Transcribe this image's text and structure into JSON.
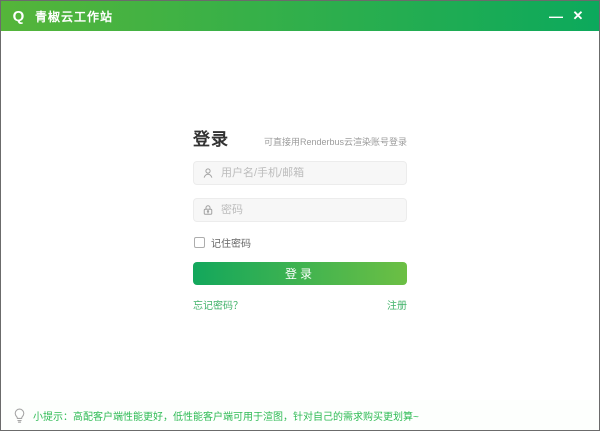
{
  "window": {
    "title": "青椒云工作站",
    "logo_glyph": "Q",
    "minimize_glyph": "—",
    "close_glyph": "✕"
  },
  "login": {
    "heading": "登录",
    "subtitle": "可直接用Renderbus云渲染账号登录",
    "username_placeholder": "用户名/手机/邮箱",
    "username_value": "",
    "password_placeholder": "密码",
    "password_value": "",
    "remember_label": "记住密码",
    "remember_checked": false,
    "submit_label": "登录",
    "forgot_label": "忘记密码？",
    "register_label": "注册"
  },
  "footer": {
    "tip": "小提示：高配客户端性能更好，低性能客户端可用于渲图，针对自己的需求购买更划算~"
  },
  "colors": {
    "titlebar_gradient_start": "#55b53a",
    "titlebar_gradient_end": "#0ca95c",
    "button_gradient_start": "#13a75c",
    "button_gradient_end": "#6cbf44",
    "link_green": "#3fb168",
    "tip_green": "#2fbb55",
    "input_bg": "#f7f7f7",
    "placeholder_gray": "#bcbcbc"
  }
}
